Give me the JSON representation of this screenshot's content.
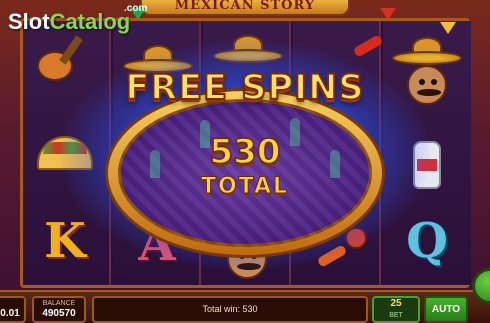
{
  "logo": {
    "part1": "Slot",
    "part2": "Catalog",
    "suffix": ".com"
  },
  "game_title": "MEXICAN STORY",
  "overlay": {
    "title": "FREE SPINS",
    "count": "530",
    "count_label": "TOTAL"
  },
  "reels": {
    "symbols": [
      "guitar",
      "taco",
      "letter-k",
      "sombrero",
      "letter-a",
      "sombrero",
      "bandit",
      "bottle",
      "maraca",
      "chili",
      "letter-q"
    ],
    "letters": {
      "k": "K",
      "a": "A",
      "q": "Q"
    }
  },
  "bottom_bar": {
    "bet_value": "0.01",
    "balance_label": "BALANCE",
    "balance_value": "490570",
    "total_win_text": "Total win: 530",
    "lines_value": "25",
    "lines_label": "BET",
    "auto_label": "AUTO"
  },
  "colors": {
    "accent_gold": "#ffd040",
    "glow_blue": "#3c78ff",
    "panel_border": "#9a5a1a",
    "auto_green": "#4ab030",
    "logo_green": "#8ad84a"
  }
}
